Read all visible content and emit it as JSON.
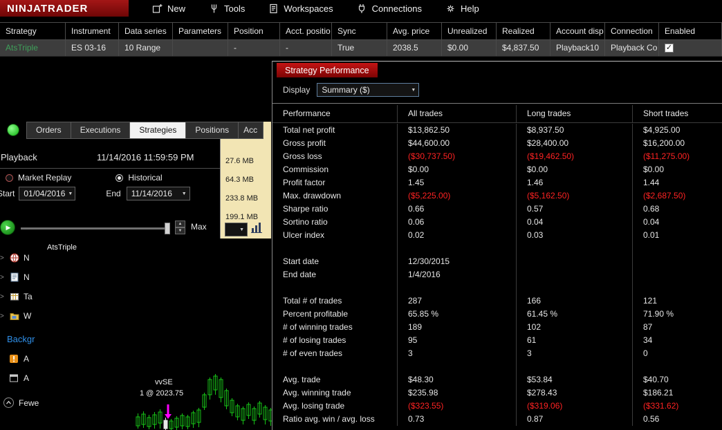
{
  "icons": {
    "check": "✓",
    "dropdown_arrow": "▼",
    "spinner_up": "▲",
    "spinner_down": "▼",
    "play": "▶",
    "tree_chevron": ">"
  },
  "colors": {
    "accent_red": "#b40000",
    "negative": "#ff2222",
    "strategy_green": "#3fa05a",
    "tan_panel": "#f2e5b4",
    "active_tab_bg": "#f2f2f2"
  },
  "menu": {
    "logo": "NINJATRADER",
    "items": [
      {
        "label": "New"
      },
      {
        "label": "Tools"
      },
      {
        "label": "Workspaces"
      },
      {
        "label": "Connections"
      },
      {
        "label": "Help"
      }
    ]
  },
  "strategy_grid": {
    "columns": [
      "Strategy",
      "Instrument",
      "Data series",
      "Parameters",
      "Position",
      "Acct. positio",
      "Sync",
      "Avg. price",
      "Unrealized",
      "Realized",
      "Account disp",
      "Connection",
      "Enabled"
    ],
    "row": {
      "strategy": "AtsTriple",
      "instrument": "ES 03-16",
      "data_series": "10 Range",
      "parameters": "",
      "position": "-",
      "acct_position": "-",
      "sync": "True",
      "avg_price": "2038.5",
      "unrealized": "$0.00",
      "realized": "$4,837.50",
      "account_display": "Playback10",
      "connection": "Playback Co",
      "enabled": true
    }
  },
  "tabs": {
    "items": [
      "Orders",
      "Executions",
      "Strategies",
      "Positions",
      "Acc"
    ],
    "active": "Strategies"
  },
  "playback": {
    "title": "Playback",
    "timestamp": "11/14/2016 11:59:59 PM",
    "mode_market_replay": "Market Replay",
    "mode_historical": "Historical",
    "selected_mode": "Historical",
    "start_label": "Start",
    "start_value": "01/04/2016",
    "end_label": "End",
    "end_value": "11/14/2016",
    "max_label": "Max"
  },
  "data_panel": {
    "sizes": [
      "27.6 MB",
      "64.3 MB",
      "233.8 MB",
      "199.1 MB"
    ]
  },
  "chart": {
    "strategy_label": "AtsTriple",
    "annotation_marker": "vvSE",
    "annotation_trade": "1 @ 2023.75"
  },
  "left_panel": {
    "items": [
      {
        "label": "N"
      },
      {
        "label": "N"
      },
      {
        "label": "Ta"
      },
      {
        "label": "W"
      }
    ],
    "background_link": "Backgr",
    "alert_items": [
      {
        "label": "A"
      },
      {
        "label": "A"
      }
    ],
    "fewer_label": "Fewe"
  },
  "performance_window": {
    "title": "Strategy Performance",
    "display_label": "Display",
    "display_value": "Summary ($)",
    "columns": [
      "Performance",
      "All trades",
      "Long trades",
      "Short trades"
    ],
    "rows": [
      {
        "label": "Total net profit",
        "all": "$13,862.50",
        "long": "$8,937.50",
        "short": "$4,925.00"
      },
      {
        "label": "Gross profit",
        "all": "$44,600.00",
        "long": "$28,400.00",
        "short": "$16,200.00"
      },
      {
        "label": "Gross loss",
        "all": "($30,737.50)",
        "long": "($19,462.50)",
        "short": "($11,275.00)"
      },
      {
        "label": "Commission",
        "all": "$0.00",
        "long": "$0.00",
        "short": "$0.00"
      },
      {
        "label": "Profit factor",
        "all": "1.45",
        "long": "1.46",
        "short": "1.44"
      },
      {
        "label": "Max. drawdown",
        "all": "($5,225.00)",
        "long": "($5,162.50)",
        "short": "($2,687.50)"
      },
      {
        "label": "Sharpe ratio",
        "all": "0.66",
        "long": "0.57",
        "short": "0.68"
      },
      {
        "label": "Sortino ratio",
        "all": "0.06",
        "long": "0.04",
        "short": "0.04"
      },
      {
        "label": "Ulcer index",
        "all": "0.02",
        "long": "0.03",
        "short": "0.01"
      },
      {
        "label": "",
        "all": "",
        "long": "",
        "short": ""
      },
      {
        "label": "Start date",
        "all": "12/30/2015",
        "long": "",
        "short": ""
      },
      {
        "label": "End date",
        "all": "1/4/2016",
        "long": "",
        "short": ""
      },
      {
        "label": "",
        "all": "",
        "long": "",
        "short": ""
      },
      {
        "label": "Total # of trades",
        "all": "287",
        "long": "166",
        "short": "121"
      },
      {
        "label": "Percent profitable",
        "all": "65.85 %",
        "long": "61.45 %",
        "short": "71.90 %"
      },
      {
        "label": "# of winning trades",
        "all": "189",
        "long": "102",
        "short": "87"
      },
      {
        "label": "# of losing trades",
        "all": "95",
        "long": "61",
        "short": "34"
      },
      {
        "label": "# of even trades",
        "all": "3",
        "long": "3",
        "short": "0"
      },
      {
        "label": "",
        "all": "",
        "long": "",
        "short": ""
      },
      {
        "label": "Avg. trade",
        "all": "$48.30",
        "long": "$53.84",
        "short": "$40.70"
      },
      {
        "label": "Avg. winning trade",
        "all": "$235.98",
        "long": "$278.43",
        "short": "$186.21"
      },
      {
        "label": "Avg. losing trade",
        "all": "($323.55)",
        "long": "($319.06)",
        "short": "($331.62)"
      },
      {
        "label": "Ratio avg. win / avg. loss",
        "all": "0.73",
        "long": "0.87",
        "short": "0.56"
      }
    ]
  }
}
